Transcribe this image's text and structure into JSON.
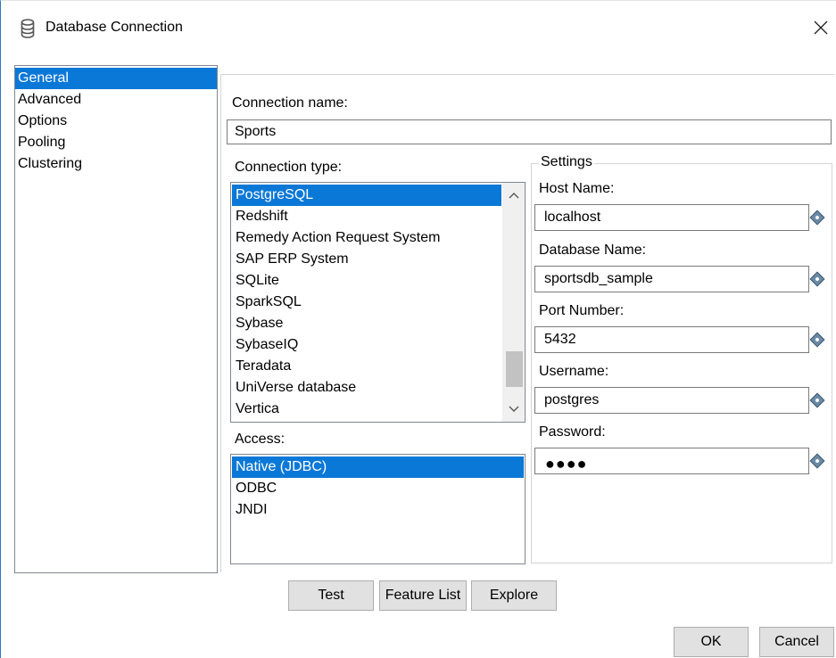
{
  "window": {
    "title": "Database Connection",
    "icon": "database-icon",
    "close_label": "✕"
  },
  "nav": {
    "items": [
      {
        "label": "General",
        "selected": true
      },
      {
        "label": "Advanced"
      },
      {
        "label": "Options"
      },
      {
        "label": "Pooling"
      },
      {
        "label": "Clustering"
      }
    ]
  },
  "general": {
    "connection_name_label": "Connection name:",
    "connection_name_value": "Sports",
    "connection_type_label": "Connection type:",
    "connection_types": [
      {
        "label": "PostgreSQL",
        "selected": true
      },
      {
        "label": "Redshift"
      },
      {
        "label": "Remedy Action Request System"
      },
      {
        "label": "SAP ERP System"
      },
      {
        "label": "SQLite"
      },
      {
        "label": "SparkSQL"
      },
      {
        "label": "Sybase"
      },
      {
        "label": "SybaseIQ"
      },
      {
        "label": "Teradata"
      },
      {
        "label": "UniVerse database"
      },
      {
        "label": "Vertica"
      }
    ],
    "access_label": "Access:",
    "access_items": [
      {
        "label": "Native (JDBC)",
        "selected": true
      },
      {
        "label": "ODBC"
      },
      {
        "label": "JNDI"
      }
    ]
  },
  "settings": {
    "title": "Settings",
    "host_label": "Host Name:",
    "host_value": "localhost",
    "db_label": "Database Name:",
    "db_value": "sportsdb_sample",
    "port_label": "Port Number:",
    "port_value": "5432",
    "user_label": "Username:",
    "user_value": "postgres",
    "password_label": "Password:",
    "password_dots": "●●●●"
  },
  "buttons": {
    "test": "Test",
    "feature_list": "Feature List",
    "explore": "Explore",
    "ok": "OK",
    "cancel": "Cancel"
  },
  "colors": {
    "selection": "#0a78d7",
    "border": "#828790"
  }
}
